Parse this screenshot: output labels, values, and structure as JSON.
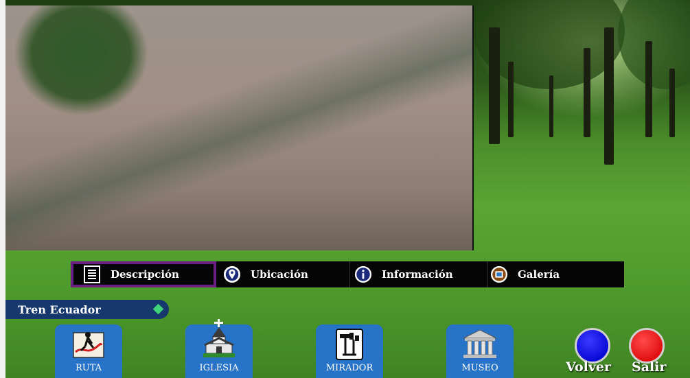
{
  "tabs": [
    {
      "label": "Descripción",
      "icon": "document-icon",
      "active": true
    },
    {
      "label": "Ubicación",
      "icon": "location-pin-icon",
      "active": false
    },
    {
      "label": "Información",
      "icon": "info-icon",
      "active": false
    },
    {
      "label": "Galería",
      "icon": "gallery-icon",
      "active": false
    }
  ],
  "location_label": "Tren Ecuador",
  "nav": [
    {
      "label": "RUTA",
      "icon": "route-map-icon"
    },
    {
      "label": "IGLESIA",
      "icon": "church-icon"
    },
    {
      "label": "MIRADOR",
      "icon": "viewpoint-icon"
    },
    {
      "label": "MUSEO",
      "icon": "museum-icon"
    }
  ],
  "actions": {
    "back_label": "Volver",
    "exit_label": "Salir"
  },
  "colors": {
    "active_tab_border": "#6a1f86",
    "nav_button": "#2773c8",
    "pill": "#16386d",
    "back_button": "#1010ee",
    "exit_button": "#ee1a1a"
  }
}
